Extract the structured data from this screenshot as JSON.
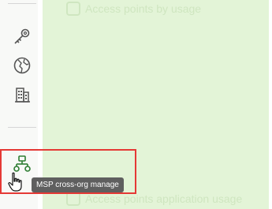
{
  "main": {
    "panels": [
      {
        "title": "Access points by usage"
      },
      {
        "title": "Access points application usage"
      }
    ]
  },
  "sidebar": {
    "items": [
      {
        "icon": "key-icon"
      },
      {
        "icon": "globe-icon"
      },
      {
        "icon": "building-icon"
      },
      {
        "icon": "org-hierarchy-icon"
      }
    ]
  },
  "tooltip": {
    "text": "MSP cross-org manage"
  },
  "colors": {
    "accent": "#2e7d32",
    "highlight": "#e53935",
    "tooltip_bg": "#5f5f5f",
    "panel_bg": "#e3f4d7"
  }
}
